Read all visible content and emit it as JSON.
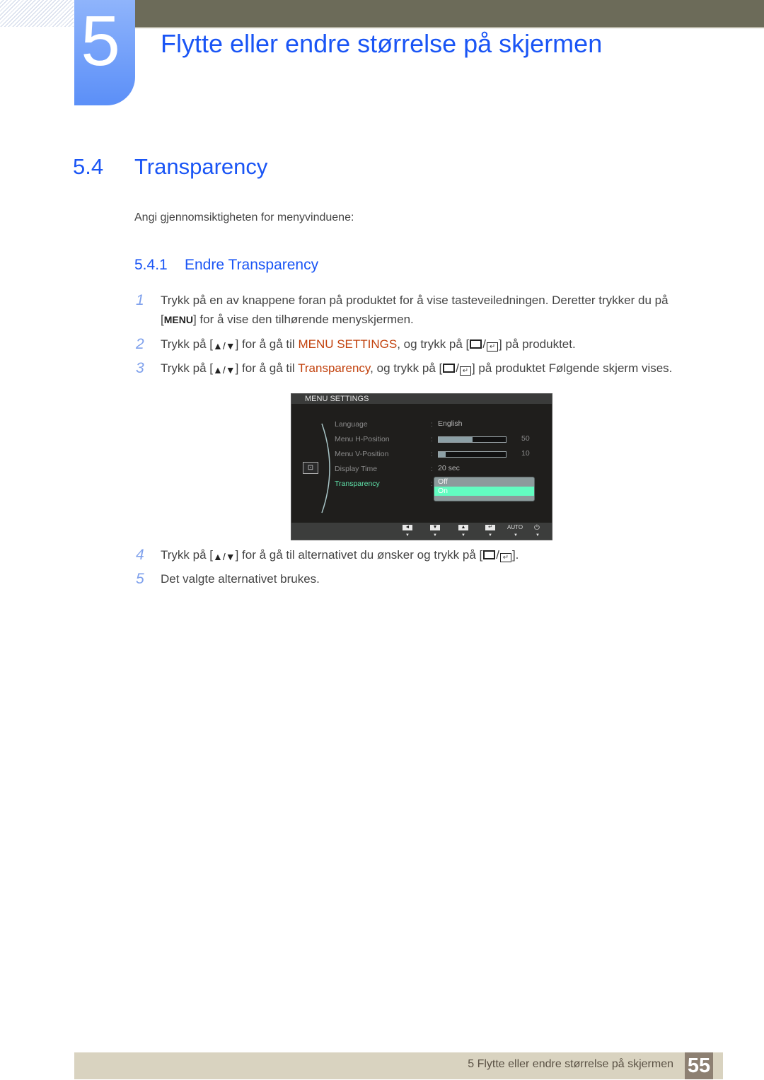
{
  "header": {
    "chapter_number": "5",
    "chapter_title": "Flytte eller endre størrelse på skjermen"
  },
  "section": {
    "number": "5.4",
    "title": "Transparency",
    "intro": "Angi gjennomsiktigheten for menyvinduene:"
  },
  "subsection": {
    "number": "5.4.1",
    "title": "Endre Transparency"
  },
  "steps": [
    {
      "n": "1",
      "line1": "Trykk på en av knappene foran på produktet for å vise tasteveiledningen. Deretter trykker du på",
      "line2_key": "MENU",
      "line2_rest": "] for å vise den tilhørende menyskjermen."
    },
    {
      "n": "2",
      "pre": "Trykk på [",
      "keys": "▲/▼",
      "mid": "] for å gå til ",
      "highlight": "MENU SETTINGS",
      "post": ", og trykk på [",
      "post2": "] på produktet."
    },
    {
      "n": "3",
      "pre": "Trykk på [",
      "keys": "▲/▼",
      "mid": "] for å gå til ",
      "highlight": "Transparency",
      "post": ", og trykk på [",
      "post2": "] på produktet Følgende skjerm vises."
    },
    {
      "n": "4",
      "pre": "Trykk på [",
      "keys": "▲/▼",
      "mid": "] for å gå til alternativet du ønsker og trykk på [",
      "post2": "]."
    },
    {
      "n": "5",
      "text": "Det valgte alternativet brukes."
    }
  ],
  "osd": {
    "title": "MENU SETTINGS",
    "items": [
      {
        "label": "Language",
        "value": "English"
      },
      {
        "label": "Menu H-Position",
        "value": "50",
        "fraction": 0.5
      },
      {
        "label": "Menu V-Position",
        "value": "10",
        "fraction": 0.1
      },
      {
        "label": "Display Time",
        "value": "20 sec"
      },
      {
        "label": "Transparency"
      }
    ],
    "colon": ":",
    "dropdown_options": [
      "Off",
      "On"
    ],
    "dropdown_selected": "On",
    "footer_buttons": [
      "◄",
      "▼",
      "▲",
      "↵",
      "AUTO",
      "⏻"
    ],
    "accent_color": "#62fdc1",
    "active_label_color": "#5fe0a8"
  },
  "footer": {
    "text": "5 Flytte eller endre størrelse på skjermen",
    "page": "55"
  },
  "colors": {
    "heading_blue": "#1a55f5",
    "highlight_orange": "#c2410c",
    "topbar": "#6c6b59",
    "footer_bg": "#d9d3c0",
    "page_badge": "#8d8072"
  }
}
